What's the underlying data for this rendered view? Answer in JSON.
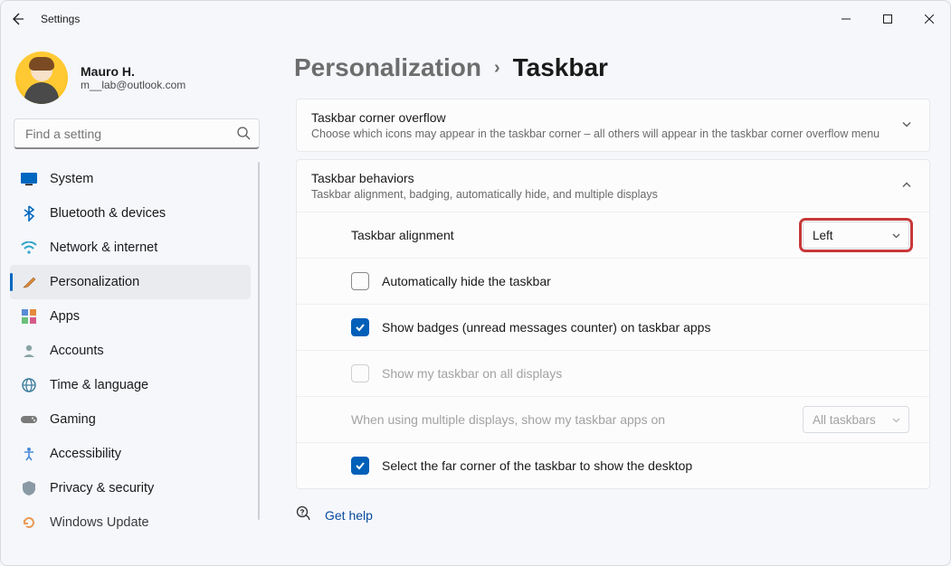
{
  "window": {
    "title": "Settings"
  },
  "profile": {
    "name": "Mauro H.",
    "email": "m__lab@outlook.com"
  },
  "search": {
    "placeholder": "Find a setting"
  },
  "nav": [
    {
      "label": "System",
      "icon": "💻",
      "color": "#0067c0"
    },
    {
      "label": "Bluetooth & devices",
      "icon": "bt"
    },
    {
      "label": "Network & internet",
      "icon": "📶",
      "color": "#2ea3c7"
    },
    {
      "label": "Personalization",
      "icon": "🖌",
      "active": true
    },
    {
      "label": "Apps",
      "icon": "▦"
    },
    {
      "label": "Accounts",
      "icon": "👤"
    },
    {
      "label": "Time & language",
      "icon": "🌐"
    },
    {
      "label": "Gaming",
      "icon": "🎮"
    },
    {
      "label": "Accessibility",
      "icon": "♿"
    },
    {
      "label": "Privacy & security",
      "icon": "🛡"
    },
    {
      "label": "Windows Update",
      "icon": "🔄"
    }
  ],
  "breadcrumb": {
    "parent": "Personalization",
    "sep": "›",
    "current": "Taskbar"
  },
  "panels": {
    "overflow": {
      "title": "Taskbar corner overflow",
      "sub": "Choose which icons may appear in the taskbar corner – all others will appear in the taskbar corner overflow menu"
    },
    "behaviors": {
      "title": "Taskbar behaviors",
      "sub": "Taskbar alignment, badging, automatically hide, and multiple displays",
      "alignment": {
        "label": "Taskbar alignment",
        "value": "Left"
      },
      "autohide": {
        "label": "Automatically hide the taskbar",
        "checked": false
      },
      "badges": {
        "label": "Show badges (unread messages counter) on taskbar apps",
        "checked": true
      },
      "allDisplays": {
        "label": "Show my taskbar on all displays",
        "checked": false,
        "disabled": true
      },
      "multi": {
        "label": "When using multiple displays, show my taskbar apps on",
        "value": "All taskbars",
        "disabled": true
      },
      "farCorner": {
        "label": "Select the far corner of the taskbar to show the desktop",
        "checked": true
      }
    }
  },
  "help": {
    "label": "Get help"
  }
}
